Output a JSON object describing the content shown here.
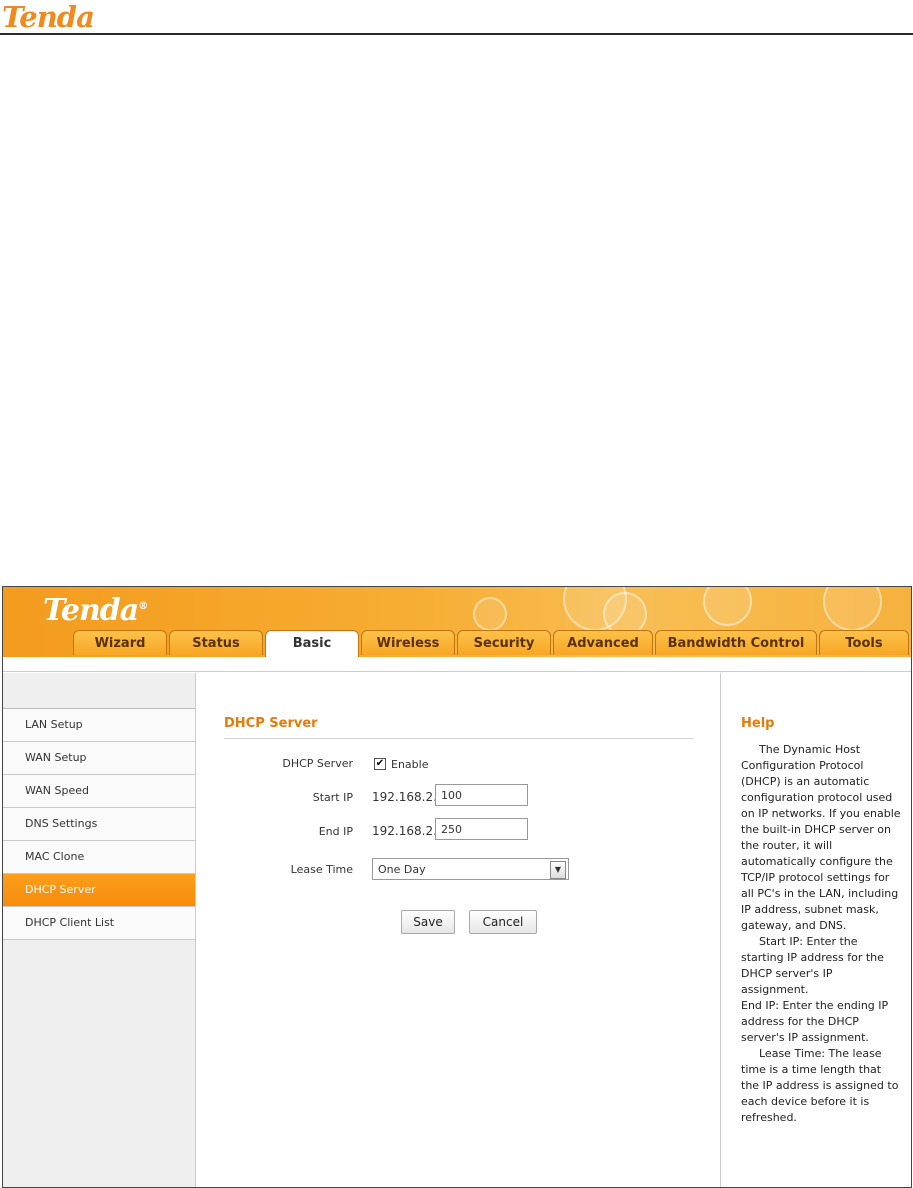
{
  "doc_header": {
    "logo": "Tenda"
  },
  "app": {
    "logo": "Tenda",
    "tabs": [
      "Wizard",
      "Status",
      "Basic",
      "Wireless",
      "Security",
      "Advanced",
      "Bandwidth Control",
      "Tools"
    ],
    "active_tab": "Basic"
  },
  "sidebar": {
    "items": [
      "LAN Setup",
      "WAN Setup",
      "WAN Speed",
      "DNS Settings",
      "MAC Clone",
      "DHCP Server",
      "DHCP Client List"
    ],
    "active": "DHCP Server"
  },
  "main": {
    "title": "DHCP Server",
    "dhcp_label": "DHCP Server",
    "enable_label": "Enable",
    "enable_checked": true,
    "start_ip_label": "Start IP",
    "start_ip_prefix": "192.168.2.",
    "start_ip_value": "100",
    "end_ip_label": "End IP",
    "end_ip_prefix": "192.168.2.",
    "end_ip_value": "250",
    "lease_label": "Lease Time",
    "lease_value": "One Day",
    "save_label": "Save",
    "cancel_label": "Cancel"
  },
  "help": {
    "title": "Help",
    "p1": "The Dynamic Host Configuration Protocol (DHCP) is an automatic configuration protocol used on IP networks. If you enable the built-in DHCP server on the router, it will automatically configure the TCP/IP protocol settings for all PC's in the LAN, including IP address, subnet mask, gateway, and DNS.",
    "p2": "Start IP: Enter the starting IP address for the DHCP server's IP assignment.",
    "p3": "End IP: Enter the ending IP address for the DHCP server's IP assignment.",
    "p4": "Lease Time: The lease time is a time length that the IP address is assigned to each device before it is refreshed."
  },
  "colors": {
    "accent": "#f08a1c",
    "active_item": "#f78b0c",
    "title": "#e87a05"
  }
}
